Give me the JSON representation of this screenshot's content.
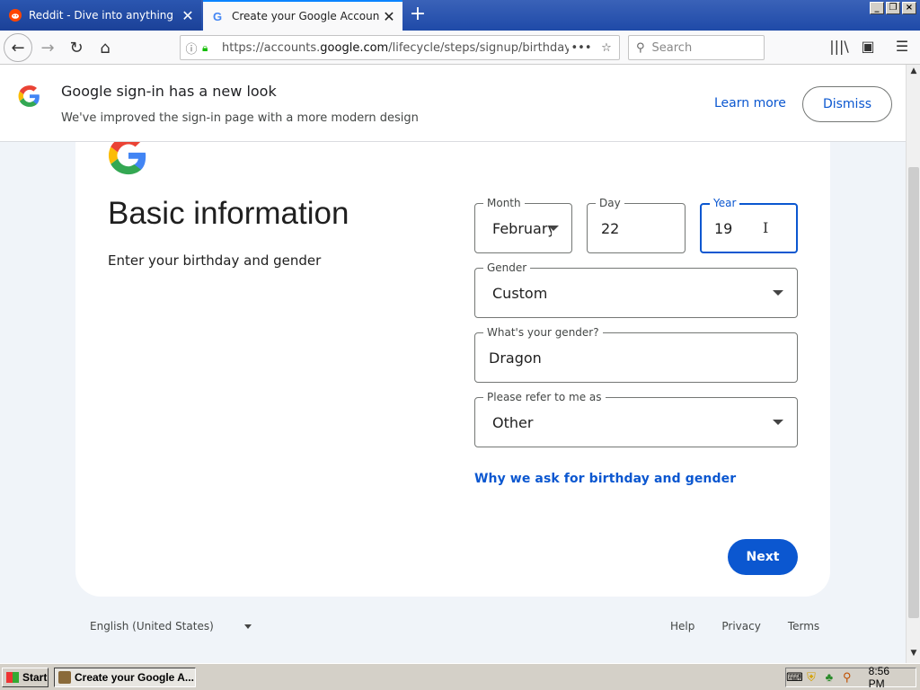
{
  "browser": {
    "tabs": [
      {
        "label": "Reddit - Dive into anything",
        "active": false
      },
      {
        "label": "Create your Google Account",
        "active": true
      }
    ],
    "url_prefix": "https://accounts.",
    "url_domain": "google.com",
    "url_suffix": "/lifecycle/steps/signup/birthdayg",
    "search_placeholder": "Search"
  },
  "banner": {
    "title": "Google sign-in has a new look",
    "subtitle": "We've improved the sign-in page with a more modern design",
    "learn_more": "Learn more",
    "dismiss": "Dismiss"
  },
  "form": {
    "heading": "Basic information",
    "subtitle": "Enter your birthday and gender",
    "month": {
      "label": "Month",
      "value": "February"
    },
    "day": {
      "label": "Day",
      "value": "22"
    },
    "year": {
      "label": "Year",
      "value": "19"
    },
    "gender": {
      "label": "Gender",
      "value": "Custom"
    },
    "custom_gender": {
      "label": "What's your gender?",
      "value": "Dragon"
    },
    "pronoun": {
      "label": "Please refer to me as",
      "value": "Other"
    },
    "why_link": "Why we ask for birthday and gender",
    "next": "Next"
  },
  "footer": {
    "language": "English (United States)",
    "links": [
      "Help",
      "Privacy",
      "Terms"
    ]
  },
  "taskbar": {
    "start": "Start",
    "task": "Create your Google A...",
    "clock": "8:56 PM"
  },
  "colors": {
    "accent": "#0b57d0",
    "card_bg": "#ffffff",
    "page_bg": "#f0f4f9"
  }
}
